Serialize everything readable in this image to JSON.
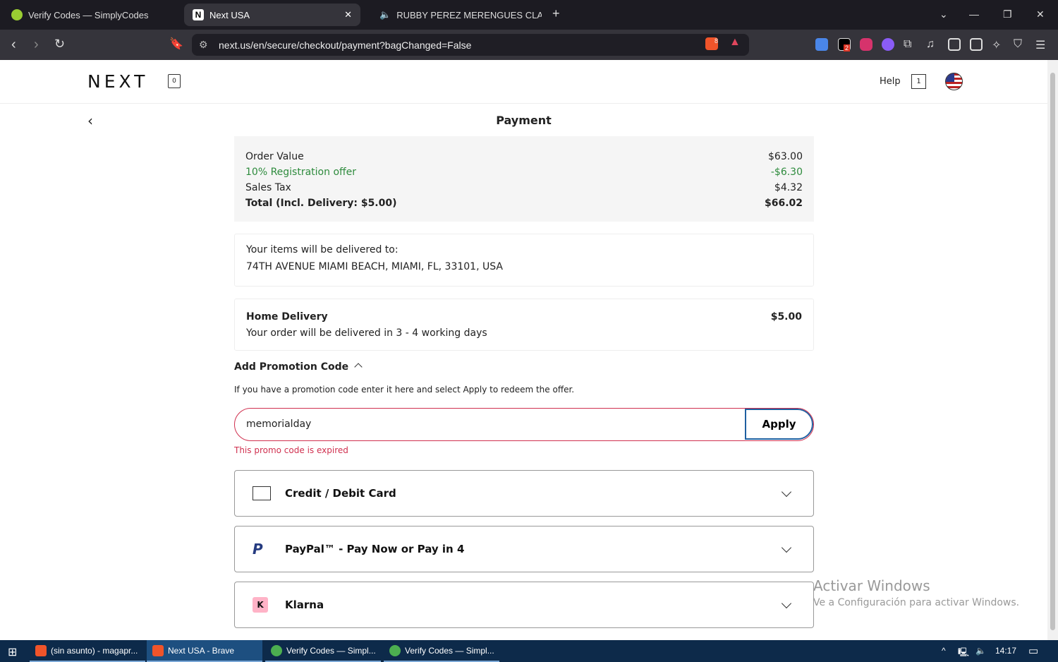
{
  "browser": {
    "tabs": [
      {
        "label": "Verify Codes — SimplyCodes"
      },
      {
        "label": "Next USA"
      },
      {
        "label": "RUBBY PEREZ MERENGUES CLASI"
      }
    ],
    "url": "next.us/en/secure/checkout/payment?bagChanged=False",
    "ext_badges": {
      "brave": "8",
      "ext2": "2"
    }
  },
  "header": {
    "logo": "NEXT",
    "bag_count": "0",
    "help": "Help",
    "cart_count": "1"
  },
  "page": {
    "title": "Payment",
    "summary": [
      {
        "label": "Order Value",
        "value": "$63.00"
      },
      {
        "label": "10% Registration offer",
        "value": "-$6.30"
      },
      {
        "label": "Sales Tax",
        "value": "$4.32"
      },
      {
        "label": "Total (Incl. Delivery: $5.00)",
        "value": "$66.02"
      }
    ],
    "delivery_label": "Your items will be delivered to:",
    "address": "74TH AVENUE MIAMI BEACH, MIAMI, FL, 33101, USA",
    "delivery_method": "Home Delivery",
    "delivery_price": "$5.00",
    "delivery_time": "Your order will be delivered in 3 - 4 working days",
    "promo": {
      "title": "Add Promotion Code",
      "hint": "If you have a promotion code enter it here and select Apply to redeem the offer.",
      "value": "memorialday",
      "apply": "Apply",
      "error": "This promo code is expired"
    },
    "payment_methods": [
      {
        "label": "Credit / Debit Card"
      },
      {
        "label": "PayPal™ - Pay Now or Pay in 4"
      },
      {
        "label": "Klarna",
        "icon_letter": "K"
      }
    ]
  },
  "watermark": {
    "title": "Activar Windows",
    "subtitle": "Ve a Configuración para activar Windows."
  },
  "taskbar": {
    "items": [
      "(sin asunto) - magapr...",
      "Next USA - Brave",
      "Verify Codes — Simpl...",
      "Verify Codes — Simpl..."
    ],
    "time": "14:17"
  },
  "colors": {
    "error": "#d0304f",
    "green": "#2e8b3d",
    "apply_border": "#1f5fa0"
  }
}
